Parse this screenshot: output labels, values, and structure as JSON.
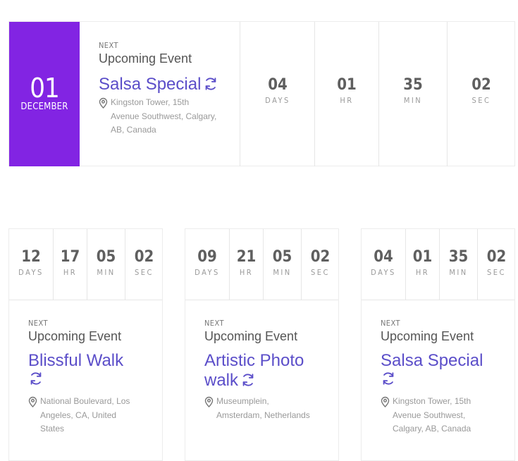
{
  "featured": {
    "day": "01",
    "month": "DECEMBER",
    "next_label": "NEXT",
    "upcoming_label": "Upcoming Event",
    "title": "Salsa Special",
    "address": [
      "Kingston Tower, 15th",
      "Avenue Southwest, Calgary,",
      "AB, Canada"
    ],
    "countdown": [
      {
        "value": "04",
        "unit": "DAYS"
      },
      {
        "value": "01",
        "unit": "HR"
      },
      {
        "value": "35",
        "unit": "MIN"
      },
      {
        "value": "02",
        "unit": "SEC"
      }
    ]
  },
  "cards": [
    {
      "countdown": [
        {
          "value": "12",
          "unit": "DAYS"
        },
        {
          "value": "17",
          "unit": "HR"
        },
        {
          "value": "05",
          "unit": "MIN"
        },
        {
          "value": "02",
          "unit": "SEC"
        }
      ],
      "next_label": "NEXT",
      "upcoming_label": "Upcoming Event",
      "title_line1": "Blissful Walk",
      "title_line2": "",
      "address": [
        "National Boulevard, Los",
        "Angeles, CA, United",
        "States"
      ]
    },
    {
      "countdown": [
        {
          "value": "09",
          "unit": "DAYS"
        },
        {
          "value": "21",
          "unit": "HR"
        },
        {
          "value": "05",
          "unit": "MIN"
        },
        {
          "value": "02",
          "unit": "SEC"
        }
      ],
      "next_label": "NEXT",
      "upcoming_label": "Upcoming Event",
      "title_line1": "Artistic Photo",
      "title_line2": "walk",
      "address": [
        "Museumplein,",
        "Amsterdam, Netherlands"
      ]
    },
    {
      "countdown": [
        {
          "value": "04",
          "unit": "DAYS"
        },
        {
          "value": "01",
          "unit": "HR"
        },
        {
          "value": "35",
          "unit": "MIN"
        },
        {
          "value": "02",
          "unit": "SEC"
        }
      ],
      "next_label": "NEXT",
      "upcoming_label": "Upcoming Event",
      "title_line1": "Salsa Special",
      "title_line2": "",
      "address": [
        "Kingston Tower, 15th",
        "Avenue Southwest,",
        "Calgary, AB, Canada"
      ]
    }
  ],
  "colors": {
    "accent": "#8224e3",
    "title": "#5b4ec9",
    "number": "#5f5f5f",
    "muted": "#999999"
  },
  "icons": {
    "repeat": "repeat-icon",
    "location": "map-pin-icon"
  }
}
